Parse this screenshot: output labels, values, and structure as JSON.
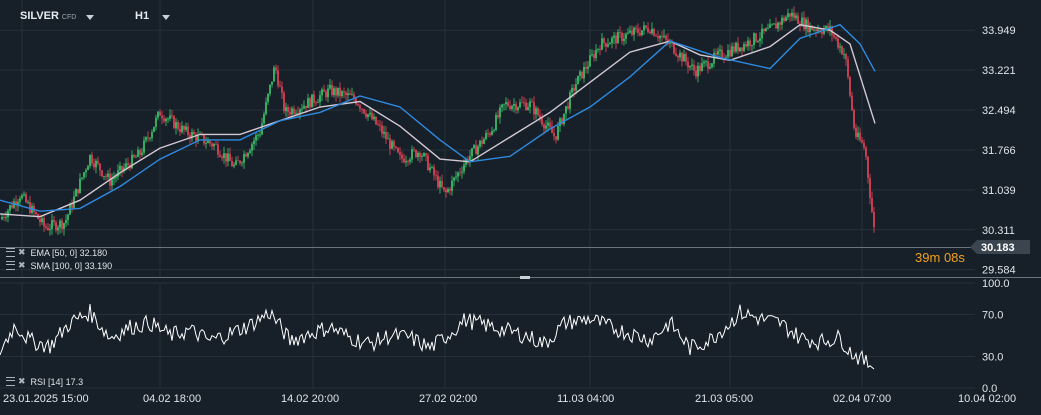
{
  "header": {
    "symbol": "SILVER",
    "symbol_tag": "CFD",
    "timeframe": "H1"
  },
  "indicators": {
    "ema_label": "EMA [50, 0] 32.180",
    "sma_label": "SMA [100, 0] 33.190",
    "rsi_label": "RSI [14] 17.3"
  },
  "countdown": {
    "minutes": "39",
    "minutes_unit": "m",
    "seconds": "08",
    "seconds_unit": "s"
  },
  "chart_data": [
    {
      "type": "candlestick",
      "title": "SILVER CFD H1",
      "y_ticks": [
        "33.949",
        "33.221",
        "32.494",
        "31.766",
        "31.039",
        "30.311",
        "29.584"
      ],
      "ylim": [
        29.45,
        34.5
      ],
      "last_price": "30.183",
      "x_ticks": [
        "23.01.2025 15:00",
        "04.02 18:00",
        "14.02 20:00",
        "27.02 02:00",
        "11.03 04:00",
        "21.03 05:00",
        "02.04 07:00",
        "10.04 02:00"
      ],
      "close_path": [
        [
          0,
          30.5
        ],
        [
          20,
          30.95
        ],
        [
          45,
          30.35
        ],
        [
          65,
          30.45
        ],
        [
          90,
          31.65
        ],
        [
          110,
          31.2
        ],
        [
          140,
          31.7
        ],
        [
          160,
          32.45
        ],
        [
          185,
          32.1
        ],
        [
          215,
          31.85
        ],
        [
          235,
          31.45
        ],
        [
          260,
          32.1
        ],
        [
          275,
          33.3
        ],
        [
          285,
          32.45
        ],
        [
          305,
          32.6
        ],
        [
          330,
          32.85
        ],
        [
          355,
          32.7
        ],
        [
          380,
          32.15
        ],
        [
          400,
          31.6
        ],
        [
          420,
          31.75
        ],
        [
          445,
          30.95
        ],
        [
          465,
          31.55
        ],
        [
          490,
          32.1
        ],
        [
          505,
          32.6
        ],
        [
          530,
          32.6
        ],
        [
          555,
          32.0
        ],
        [
          575,
          32.95
        ],
        [
          600,
          33.7
        ],
        [
          625,
          33.85
        ],
        [
          650,
          34.0
        ],
        [
          675,
          33.6
        ],
        [
          695,
          33.2
        ],
        [
          720,
          33.5
        ],
        [
          745,
          33.7
        ],
        [
          770,
          33.95
        ],
        [
          790,
          34.25
        ],
        [
          810,
          34.0
        ],
        [
          830,
          33.95
        ],
        [
          845,
          33.5
        ],
        [
          855,
          32.05
        ],
        [
          865,
          31.8
        ],
        [
          875,
          30.15
        ]
      ],
      "series": [
        {
          "name": "EMA [50, 0]",
          "color": "#d4c8d4",
          "points": [
            [
              0,
              30.6
            ],
            [
              40,
              30.55
            ],
            [
              80,
              30.85
            ],
            [
              120,
              31.35
            ],
            [
              160,
              31.8
            ],
            [
              200,
              32.05
            ],
            [
              240,
              32.05
            ],
            [
              280,
              32.3
            ],
            [
              320,
              32.55
            ],
            [
              360,
              32.65
            ],
            [
              400,
              32.2
            ],
            [
              440,
              31.6
            ],
            [
              470,
              31.55
            ],
            [
              510,
              32.0
            ],
            [
              550,
              32.45
            ],
            [
              590,
              33.0
            ],
            [
              630,
              33.55
            ],
            [
              670,
              33.75
            ],
            [
              700,
              33.5
            ],
            [
              730,
              33.4
            ],
            [
              770,
              33.65
            ],
            [
              800,
              34.05
            ],
            [
              830,
              33.95
            ],
            [
              850,
              33.7
            ],
            [
              875,
              32.25
            ]
          ]
        },
        {
          "name": "SMA [100, 0]",
          "color": "#2e8ae0",
          "points": [
            [
              0,
              30.85
            ],
            [
              40,
              30.65
            ],
            [
              80,
              30.7
            ],
            [
              120,
              31.1
            ],
            [
              160,
              31.6
            ],
            [
              200,
              31.95
            ],
            [
              240,
              31.95
            ],
            [
              280,
              32.3
            ],
            [
              320,
              32.45
            ],
            [
              360,
              32.75
            ],
            [
              400,
              32.55
            ],
            [
              440,
              31.95
            ],
            [
              470,
              31.55
            ],
            [
              510,
              31.65
            ],
            [
              550,
              32.15
            ],
            [
              590,
              32.55
            ],
            [
              630,
              33.1
            ],
            [
              670,
              33.75
            ],
            [
              720,
              33.45
            ],
            [
              770,
              33.25
            ],
            [
              800,
              33.8
            ],
            [
              840,
              34.05
            ],
            [
              860,
              33.7
            ],
            [
              875,
              33.2
            ]
          ]
        }
      ]
    },
    {
      "type": "line",
      "title": "RSI [14]",
      "y_ticks": [
        "100.0",
        "70.0",
        "30.0",
        "0.0"
      ],
      "ylim": [
        0,
        100
      ],
      "series": [
        {
          "name": "RSI [14]",
          "color": "#ffffff",
          "points": [
            [
              0,
              35
            ],
            [
              15,
              60
            ],
            [
              30,
              45
            ],
            [
              50,
              40
            ],
            [
              70,
              62
            ],
            [
              90,
              72
            ],
            [
              110,
              48
            ],
            [
              130,
              58
            ],
            [
              150,
              62
            ],
            [
              170,
              50
            ],
            [
              190,
              55
            ],
            [
              210,
              45
            ],
            [
              230,
              52
            ],
            [
              250,
              60
            ],
            [
              270,
              72
            ],
            [
              290,
              45
            ],
            [
              310,
              52
            ],
            [
              330,
              58
            ],
            [
              350,
              48
            ],
            [
              370,
              42
            ],
            [
              390,
              50
            ],
            [
              410,
              48
            ],
            [
              430,
              38
            ],
            [
              450,
              52
            ],
            [
              465,
              65
            ],
            [
              485,
              60
            ],
            [
              505,
              55
            ],
            [
              525,
              50
            ],
            [
              545,
              42
            ],
            [
              565,
              62
            ],
            [
              590,
              66
            ],
            [
              610,
              58
            ],
            [
              630,
              52
            ],
            [
              650,
              46
            ],
            [
              670,
              62
            ],
            [
              690,
              38
            ],
            [
              710,
              46
            ],
            [
              730,
              62
            ],
            [
              740,
              72
            ],
            [
              760,
              66
            ],
            [
              780,
              62
            ],
            [
              800,
              48
            ],
            [
              820,
              44
            ],
            [
              840,
              48
            ],
            [
              850,
              35
            ],
            [
              865,
              25
            ],
            [
              875,
              17.3
            ]
          ]
        }
      ]
    }
  ]
}
